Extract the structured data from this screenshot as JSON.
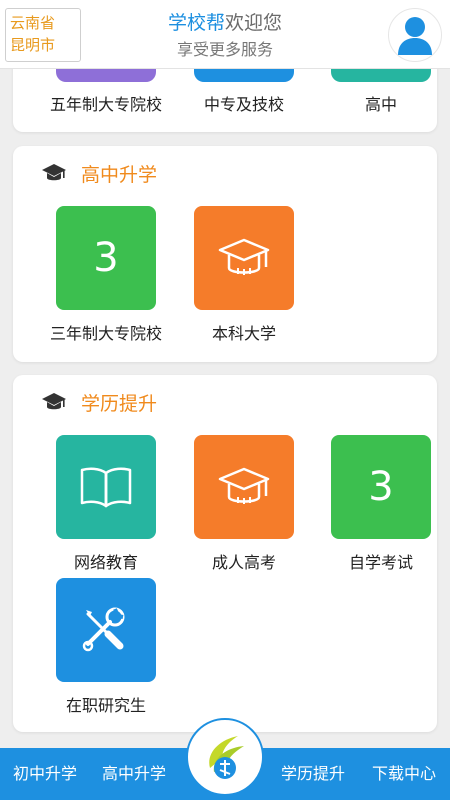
{
  "header": {
    "location_line1": "云南省",
    "location_line2": "昆明市",
    "brand": "学校帮",
    "greeting": "欢迎您",
    "subtitle": "享受更多服务"
  },
  "section_top": {
    "items": [
      {
        "label": "五年制大专院校",
        "color": "#8e6fd8"
      },
      {
        "label": "中专及技校",
        "color": "#1e90e0"
      },
      {
        "label": "高中",
        "color": "#26b5a0"
      }
    ]
  },
  "section_gaozhong": {
    "title": "高中升学",
    "items": [
      {
        "label": "三年制大专院校",
        "color": "#3cbf4f",
        "icon": "digit-3-icon",
        "digit": "3"
      },
      {
        "label": "本科大学",
        "color": "#f57c2a",
        "icon": "graduation-cap-icon"
      }
    ]
  },
  "section_xueli": {
    "title": "学历提升",
    "items": [
      {
        "label": "网络教育",
        "color": "#26b5a0",
        "icon": "book-icon"
      },
      {
        "label": "成人高考",
        "color": "#f57c2a",
        "icon": "graduation-cap-icon"
      },
      {
        "label": "自学考试",
        "color": "#3cbf4f",
        "icon": "digit-3-icon",
        "digit": "3"
      },
      {
        "label": "在职研究生",
        "color": "#1e90e0",
        "icon": "tools-icon"
      }
    ]
  },
  "bottom_nav": {
    "items": [
      "初中升学",
      "高中升学",
      "学历提升",
      "下载中心"
    ]
  },
  "colors": {
    "accent_blue": "#1e90e0",
    "accent_orange": "#f08a1c"
  }
}
